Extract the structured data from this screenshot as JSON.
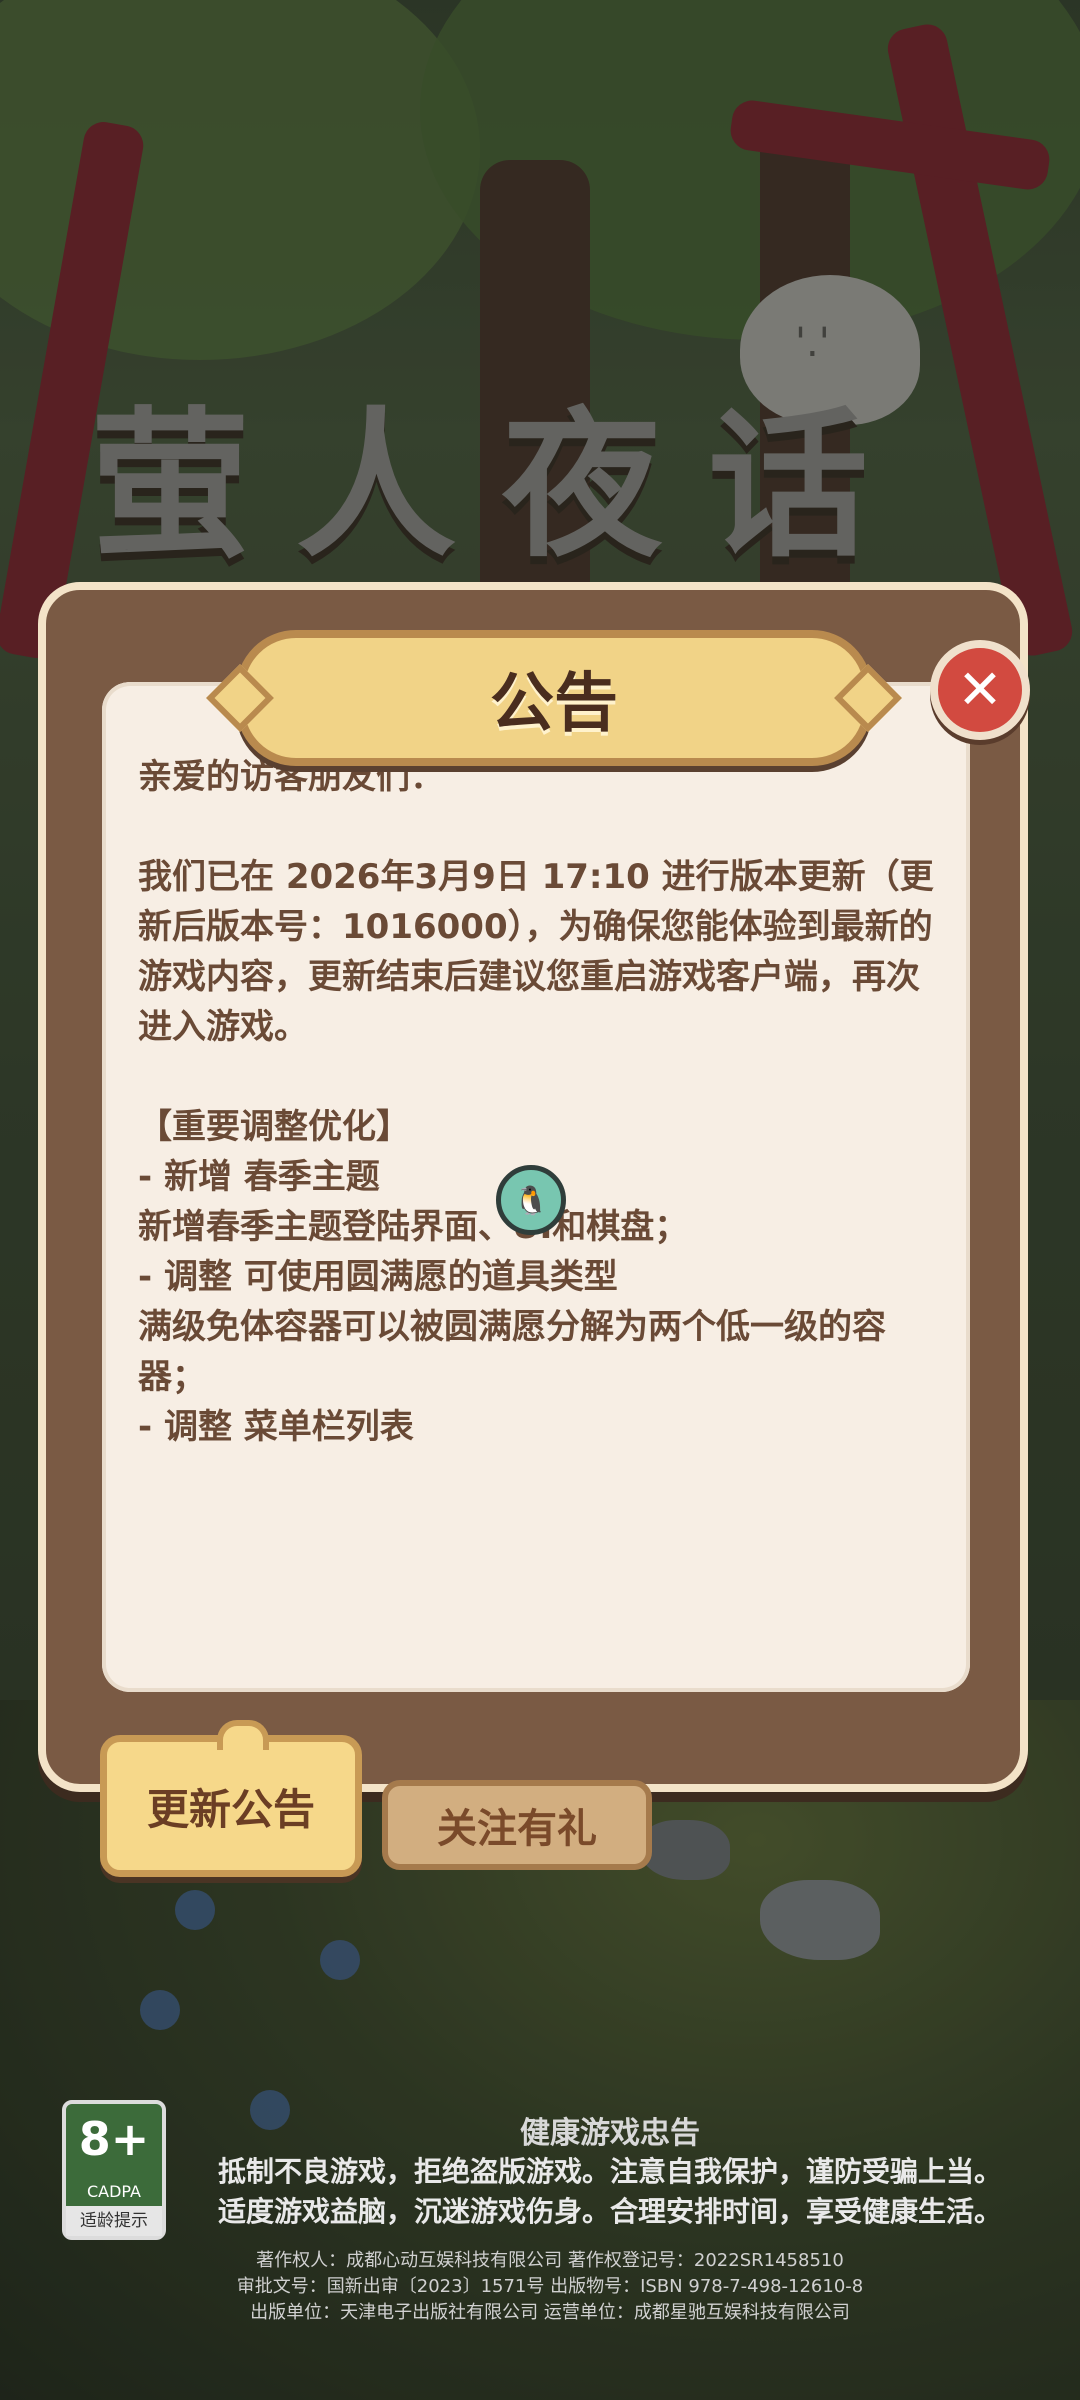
{
  "logo": {
    "chars": [
      "萤",
      "人",
      "夜",
      "话"
    ]
  },
  "dialog": {
    "title": "公告",
    "close_glyph": "✕",
    "content": "亲爱的访客朋友们：\n\n我们已在 2026年3月9日 17:10 进行版本更新（更新后版本号：1016000），为确保您能体验到最新的游戏内容，更新结束后建议您重启游戏客户端，再次进入游戏。\n\n【重要调整优化】\n- 新增 春季主题\n新增春季主题登陆界面、UI和棋盘；\n- 调整 可使用圆满愿的道具类型\n满级免体容器可以被圆满愿分解为两个低一级的容器；\n- 调整 菜单栏列表"
  },
  "tabs": {
    "active": "更新公告",
    "inactive": "关注有礼"
  },
  "age_rating": {
    "age": "8+",
    "org": "CADPA",
    "label": "适龄提示"
  },
  "health_advice": {
    "heading": "健康游戏忠告",
    "line1": "抵制不良游戏，拒绝盗版游戏。注意自我保护，谨防受骗上当。",
    "line2": "适度游戏益脑，沉迷游戏伤身。合理安排时间，享受健康生活。"
  },
  "credits": {
    "line1": "著作权人：成都心动互娱科技有限公司    著作权登记号：2022SR1458510",
    "line2": "审批文号：国新出审〔2023〕1571号    出版物号：ISBN 978-7-498-12610-8",
    "line3": "出版单位：天津电子出版社有限公司    运营单位：成都星驰互娱科技有限公司"
  },
  "colors": {
    "dialog_frame": "#7a5a44",
    "paper": "#f7eee4",
    "title_plate": "#f1d387",
    "close_button": "#d24a40",
    "text_brown": "#6a4a36"
  }
}
